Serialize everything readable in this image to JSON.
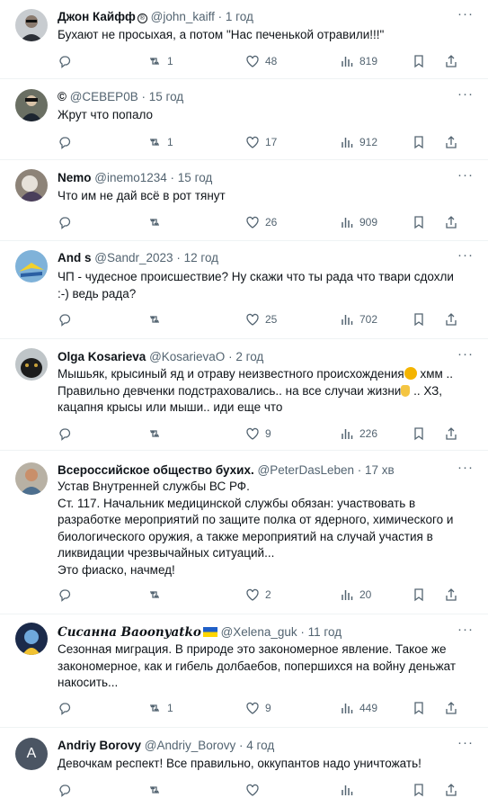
{
  "tweets": [
    {
      "name": "Джон Кайфф",
      "badge": "®",
      "handle": "@john_kaiff",
      "time": "1 год",
      "lines": [
        "Бухают не просыхая, а потом \"Нас печенькой отравили!!!\""
      ],
      "replies": "",
      "retweets": "1",
      "likes": "48",
      "views": "819"
    },
    {
      "name": "©",
      "handle": "@СЕВЕР0В",
      "time": "15 год",
      "lines": [
        "Жрут что попало"
      ],
      "replies": "",
      "retweets": "1",
      "likes": "17",
      "views": "912"
    },
    {
      "name": "Nemo",
      "handle": "@inemo1234",
      "time": "15 год",
      "lines": [
        "Что им не дай всё в рот тянут"
      ],
      "replies": "",
      "retweets": "",
      "likes": "26",
      "views": "909"
    },
    {
      "name": "And s",
      "handle": "@Sandr_2023",
      "time": "12 год",
      "lines": [
        "ЧП - чудесное происшествие? Ну скажи что ты рада что твари сдохли",
        "  :-) ведь рада?"
      ],
      "replies": "",
      "retweets": "",
      "likes": "25",
      "views": "702"
    },
    {
      "name": "Olga Kosarieva",
      "handle": "@KosarievaO",
      "time": "2 год",
      "lines": [
        "Мышьяк, крысиный яд и отраву неизвестного происхождения",
        "Правильно девченки подстраховались.. на все случаи жизни",
        "кацапня крысы или мыши.. иди еще что"
      ],
      "line_tail_0": " хмм ..",
      "line_tail_1": " .. ХЗ,",
      "replies": "",
      "retweets": "",
      "likes": "9",
      "views": "226"
    },
    {
      "name": "Всероссийское общество бухих.",
      "handle": "@PeterDasLeben",
      "time": "17 хв",
      "lines": [
        "Устав Внутренней службы ВС РФ.",
        "Ст. 117. Начальник медицинской службы обязан: участвовать в",
        "разработке мероприятий по защите полка от ядерного, химического и",
        "биологического оружия, а также мероприятий на случай участия в",
        "ликвидации чрезвычайных ситуаций...",
        "Это фиаско, начмед!"
      ],
      "replies": "",
      "retweets": "",
      "likes": "2",
      "views": "20"
    },
    {
      "name": "Сиcанна Вaoоnyatkо",
      "handle": "@Xelena_guk",
      "time": "11 год",
      "lines": [
        "Сезонная миграция. В природе это закономерное явление. Такое же",
        "закономерное, как и гибель долбаебов, попершихся на войну деньжат",
        "накосить..."
      ],
      "replies": "",
      "retweets": "1",
      "likes": "9",
      "views": "449"
    },
    {
      "name": "Andriy Borovy",
      "handle": "@Andriy_Borovy",
      "time": "4 год",
      "avatar_letter": "A",
      "lines": [
        "Девочкам респект! Все правильно, оккупантов надо уничтожать!"
      ],
      "replies": "",
      "retweets": "",
      "likes": "",
      "views": ""
    }
  ],
  "colors": {
    "text": "#0f1419",
    "secondary": "#536471",
    "divider": "#eff3f4"
  }
}
